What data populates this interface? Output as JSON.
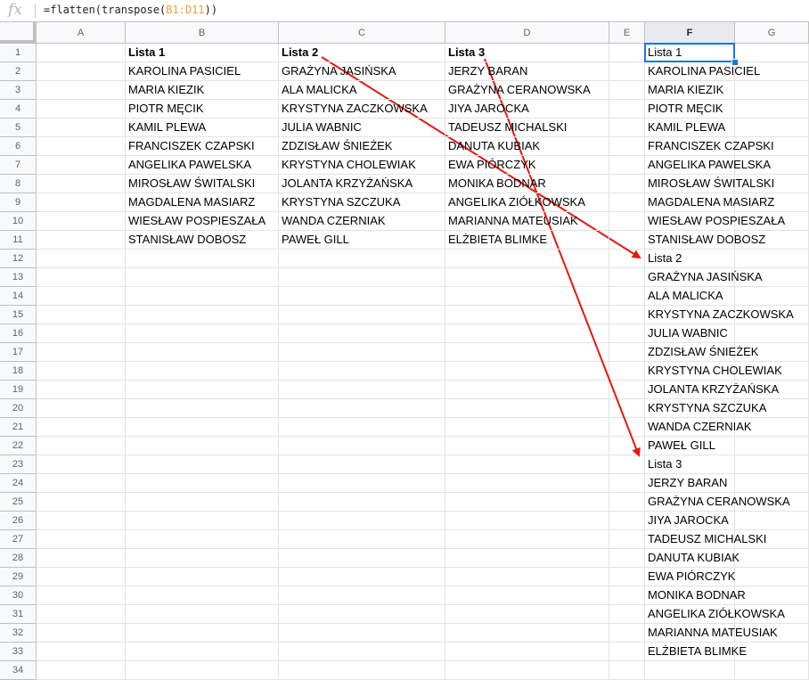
{
  "formula_bar": {
    "fx_label": "fx",
    "formula_prefix": "=flatten(transpose(",
    "formula_ref": "B1:D11",
    "formula_suffix": "))"
  },
  "columns": [
    "A",
    "B",
    "C",
    "D",
    "E",
    "F",
    "G"
  ],
  "selected_column": "F",
  "rows": [
    "1",
    "2",
    "3",
    "4",
    "5",
    "6",
    "7",
    "8",
    "9",
    "10",
    "11",
    "12",
    "13",
    "14",
    "15",
    "16",
    "17",
    "18",
    "19",
    "20",
    "21",
    "22",
    "23",
    "24",
    "25",
    "26",
    "27",
    "28",
    "29",
    "30",
    "31",
    "32",
    "33",
    "34"
  ],
  "source_lists": {
    "B": [
      "Lista 1",
      "KAROLINA PASICIEL",
      "MARIA KIEZIK",
      "PIOTR MĘCIK",
      "KAMIL PLEWA",
      "FRANCISZEK CZAPSKI",
      "ANGELIKA PAWELSKA",
      "MIROSŁAW ŚWITALSKI",
      "MAGDALENA MASIARZ",
      "WIESŁAW POSPIESZAŁA",
      "STANISŁAW DOBOSZ"
    ],
    "C": [
      "Lista 2",
      "GRAŻYNA JASIŃSKA",
      "ALA MALICKA",
      "KRYSTYNA ZACZKOWSKA",
      "JULIA WABNIC",
      "ZDZISŁAW ŚNIEŻEK",
      "KRYSTYNA CHOLEWIAK",
      "JOLANTA KRZYŻAŃSKA",
      "KRYSTYNA SZCZUKA",
      "WANDA CZERNIAK",
      "PAWEŁ GILL"
    ],
    "D": [
      "Lista 3",
      "JERZY BARAN",
      "GRAŻYNA CERANOWSKA",
      "JIYA JAROCKA",
      "TADEUSZ MICHALSKI",
      "DANUTA KUBIAK",
      "EWA PIÓRCZYK",
      "MONIKA BODNAR",
      "ANGELIKA ZIÓŁKOWSKA",
      "MARIANNA MATEUSIAK",
      "ELŻBIETA BLIMKE"
    ]
  },
  "result_column_F": [
    "Lista 1",
    "KAROLINA PASICIEL",
    "MARIA KIEZIK",
    "PIOTR MĘCIK",
    "KAMIL PLEWA",
    "FRANCISZEK CZAPSKI",
    "ANGELIKA PAWELSKA",
    "MIROSŁAW ŚWITALSKI",
    "MAGDALENA MASIARZ",
    "WIESŁAW POSPIESZAŁA",
    "STANISŁAW DOBOSZ",
    "Lista 2",
    "GRAŻYNA JASIŃSKA",
    "ALA MALICKA",
    "KRYSTYNA ZACZKOWSKA",
    "JULIA WABNIC",
    "ZDZISŁAW ŚNIEŻEK",
    "KRYSTYNA CHOLEWIAK",
    "JOLANTA KRZYŻAŃSKA",
    "KRYSTYNA SZCZUKA",
    "WANDA CZERNIAK",
    "PAWEŁ GILL",
    "Lista 3",
    "JERZY BARAN",
    "GRAŻYNA CERANOWSKA",
    "JIYA JAROCKA",
    "TADEUSZ MICHALSKI",
    "DANUTA KUBIAK",
    "EWA PIÓRCZYK",
    "MONIKA BODNAR",
    "ANGELIKA ZIÓŁKOWSKA",
    "MARIANNA MATEUSIAK",
    "ELŻBIETA BLIMKE"
  ],
  "active_cell": "F1",
  "colors": {
    "accent": "#1a73e8",
    "arrow": "#e8170d",
    "formula_ref": "#e8a33d"
  }
}
